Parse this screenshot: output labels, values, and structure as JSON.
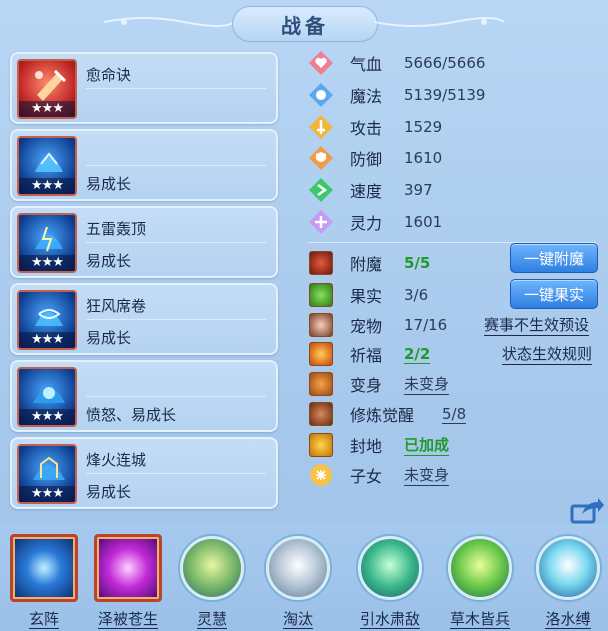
{
  "title": "战备",
  "cards": [
    {
      "line1": "愈命诀",
      "line2": "",
      "stars": "★★★",
      "theme": "red"
    },
    {
      "line1": "",
      "line2": "易成长",
      "stars": "★★★",
      "theme": "blue"
    },
    {
      "line1": "五雷轰顶",
      "line2": "易成长",
      "stars": "★★★",
      "theme": "blue"
    },
    {
      "line1": "狂风席卷",
      "line2": "易成长",
      "stars": "★★★",
      "theme": "blue"
    },
    {
      "line1": "",
      "line2": "愤怒、易成长",
      "stars": "★★★",
      "theme": "blue"
    },
    {
      "line1": "烽火连城",
      "line2": "易成长",
      "stars": "★★★",
      "theme": "blue"
    }
  ],
  "stats": [
    {
      "label": "气血",
      "value": "5666/5666",
      "icon": "heart-icon"
    },
    {
      "label": "魔法",
      "value": "5139/5139",
      "icon": "mana-icon"
    },
    {
      "label": "攻击",
      "value": "1529",
      "icon": "sword-icon"
    },
    {
      "label": "防御",
      "value": "1610",
      "icon": "shield-icon"
    },
    {
      "label": "速度",
      "value": "397",
      "icon": "speed-icon"
    },
    {
      "label": "灵力",
      "value": "1601",
      "icon": "spirit-icon"
    }
  ],
  "extras": [
    {
      "label": "附魔",
      "value": "5/5",
      "icon": "enchant-icon"
    },
    {
      "label": "果实",
      "value": "3/6",
      "icon": "fruit-icon"
    },
    {
      "label": "宠物",
      "value": "17/16",
      "icon": "pet-icon"
    },
    {
      "label": "祈福",
      "value": "2/2",
      "icon": "blessing-icon"
    },
    {
      "label": "变身",
      "value": "未变身",
      "icon": "transform-icon"
    },
    {
      "label": "修炼觉醒",
      "value": "5/8",
      "icon": "cultivation-icon"
    },
    {
      "label": "封地",
      "value": "已加成",
      "icon": "fief-icon"
    },
    {
      "label": "子女",
      "value": "未变身",
      "icon": "child-icon"
    }
  ],
  "buttons": {
    "enchant": "一键附魔",
    "fruit": "一键果实"
  },
  "links": {
    "event_preset": "赛事不生效预设",
    "status_rules": "状态生效规则"
  },
  "bottom_skills": [
    {
      "name": "玄阵",
      "icon": "formation-icon"
    },
    {
      "name": "泽被苍生",
      "icon": "blessing-hand-icon"
    },
    {
      "name": "灵慧",
      "icon": "wisdom-icon"
    },
    {
      "name": "淘汰",
      "icon": "eliminate-icon"
    },
    {
      "name": "引水肃敌",
      "icon": "water-icon"
    },
    {
      "name": "草木皆兵",
      "icon": "forest-icon"
    },
    {
      "name": "洛水缚",
      "icon": "river-bind-icon"
    }
  ],
  "colors": {
    "background": "#a9ccee",
    "green_value": "#1f9a2a",
    "button_blue": "#2f7fe0"
  }
}
